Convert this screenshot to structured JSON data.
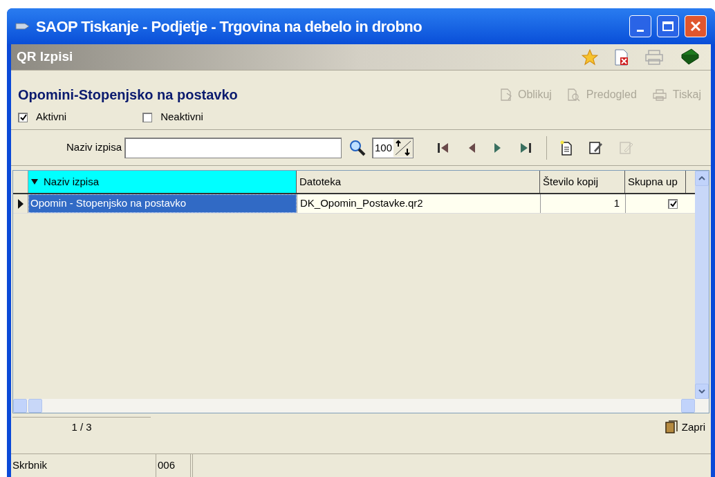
{
  "window": {
    "title": "SAOP Tiskanje - Podjetje - Trgovina na debelo in drobno"
  },
  "subheader": {
    "title": "QR Izpisi"
  },
  "heading": "Opomini-Stopenjsko na postavko",
  "actions": [
    {
      "label": "Oblikuj",
      "disabled": true
    },
    {
      "label": "Predogled",
      "disabled": true
    },
    {
      "label": "Tiskaj",
      "disabled": true
    }
  ],
  "filters": [
    {
      "label": "Aktivni",
      "checked": true
    },
    {
      "label": "Neaktivni",
      "checked": false
    }
  ],
  "search": {
    "label": "Naziv izpisa",
    "zoom": "100"
  },
  "table": {
    "columns": [
      {
        "label": "Naziv izpisa",
        "sorted": true
      },
      {
        "label": "Datoteka",
        "sorted": false
      },
      {
        "label": "Število kopij",
        "sorted": false
      },
      {
        "label": "Skupna up",
        "sorted": false
      }
    ],
    "rows": [
      {
        "selected": true,
        "name": "Opomin - Stopenjsko na postavko",
        "file": "DK_Opomin_Postavke.qr2",
        "copies": "1",
        "combined": true
      }
    ]
  },
  "pager": "1 / 3",
  "close_button": "Zapri",
  "status_bar": [
    "Skrbnik",
    "006"
  ]
}
